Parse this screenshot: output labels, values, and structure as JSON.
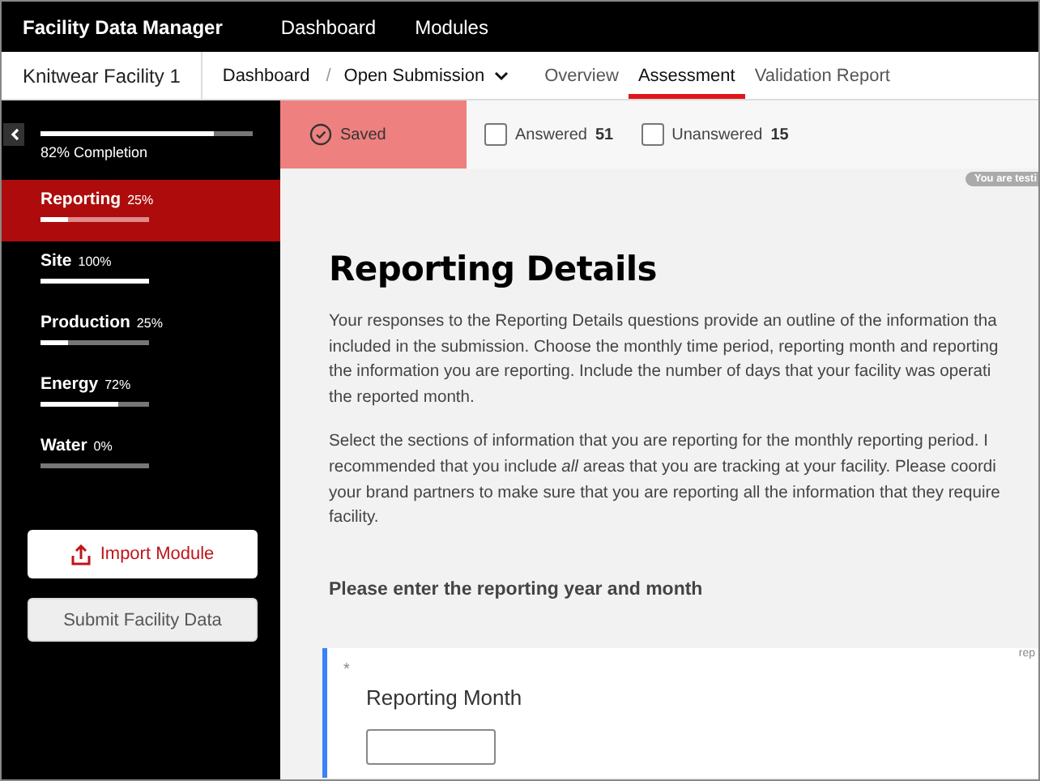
{
  "app": {
    "title": "Facility Data Manager",
    "nav": [
      {
        "label": "Dashboard"
      },
      {
        "label": "Modules"
      }
    ]
  },
  "subnav": {
    "facility": "Knitwear Facility 1",
    "breadcrumb": [
      "Dashboard",
      "/"
    ],
    "submission": "Open Submission",
    "tabs": [
      {
        "label": "Overview",
        "selected": false
      },
      {
        "label": "Assessment",
        "selected": true
      },
      {
        "label": "Validation Report",
        "selected": false
      }
    ]
  },
  "sidebar": {
    "completion": {
      "label": "82% Completion",
      "level": 0.82
    },
    "sections": [
      {
        "name": "Reporting",
        "percent": "25%",
        "level": 0.25,
        "selected": true
      },
      {
        "name": "Site",
        "percent": "100%",
        "level": 1,
        "selected": false
      },
      {
        "name": "Production",
        "percent": "25%",
        "level": 0.25,
        "selected": false
      },
      {
        "name": "Energy",
        "percent": "72%",
        "level": 0.72,
        "selected": false
      },
      {
        "name": "Water",
        "percent": "0%",
        "level": 0,
        "selected": false
      }
    ],
    "import_button": "Import Module",
    "submit_button": "Submit Facility Data"
  },
  "status": {
    "saved": "Saved",
    "filters": [
      {
        "label": "Answered",
        "count": "51",
        "checked": false
      },
      {
        "label": "Unanswered",
        "count": "15",
        "checked": false
      }
    ]
  },
  "test_badge": "You are testi",
  "content": {
    "title": "Reporting Details",
    "paragraphs": [
      [
        "Your responses to the Reporting Details questions provide an outline of the information tha",
        "included in the submission. Choose the monthly time period, reporting month and reporting",
        "the information you are reporting. Include the number of days that your facility was operati",
        "the reported month."
      ],
      [
        "Select the sections of information that you are reporting for the monthly reporting period. I",
        "recommended that you include *all* areas that you are tracking at your facility. Please coordi",
        "your brand partners to make sure that you are reporting all the information that they require",
        "facility."
      ]
    ],
    "prompt": "Please enter the reporting year and month",
    "question": {
      "required_mark": "*",
      "title": "Reporting Month",
      "tag": "rep"
    }
  }
}
